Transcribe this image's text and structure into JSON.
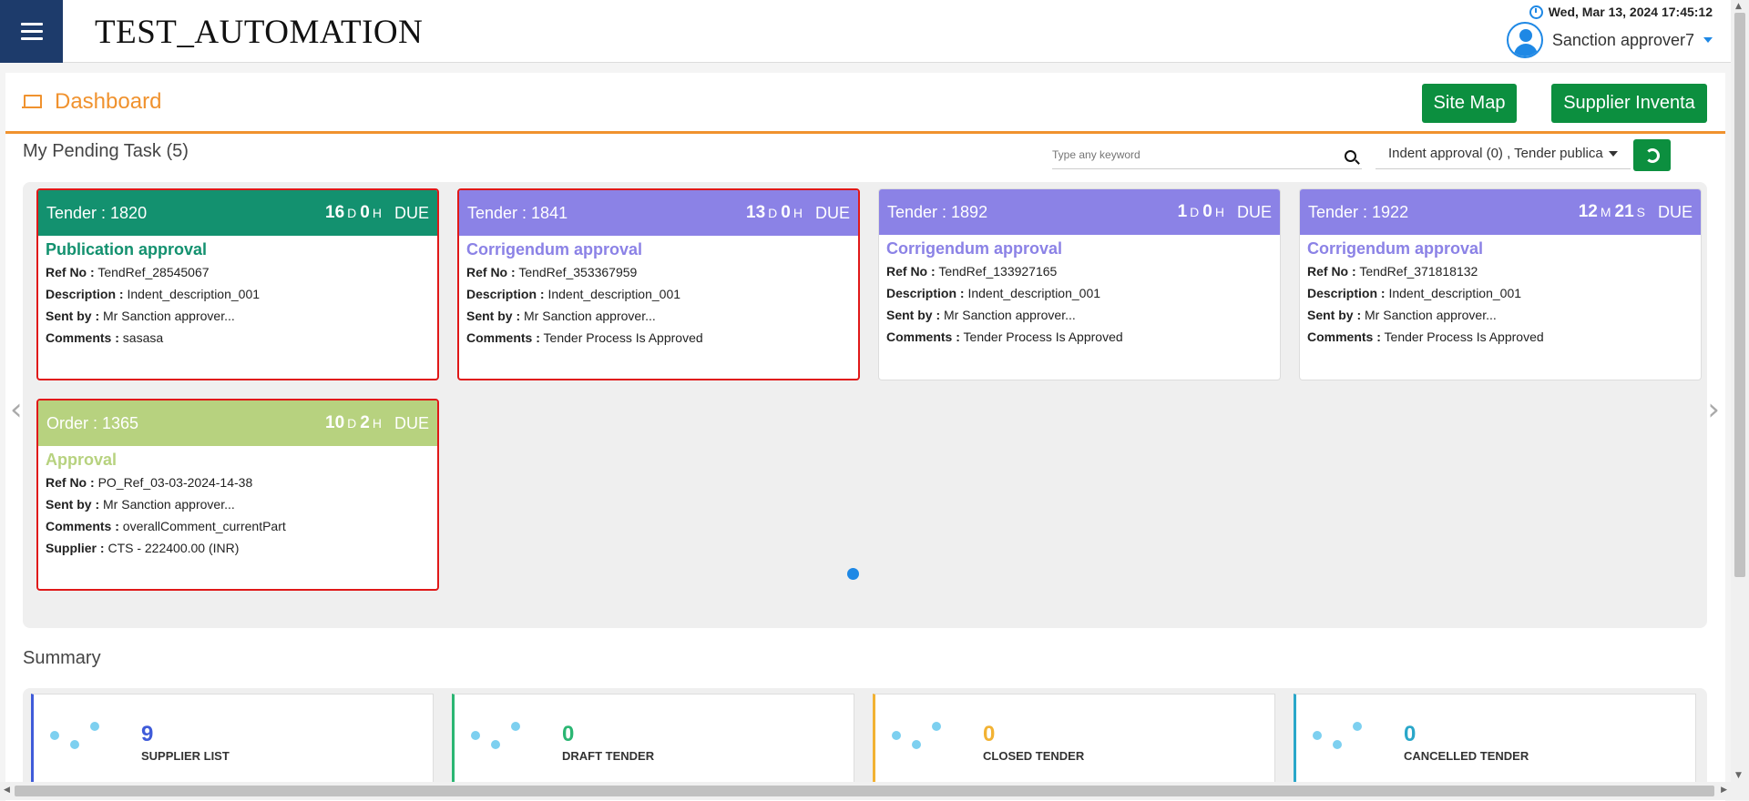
{
  "header": {
    "app_title": "TEST_AUTOMATION",
    "datetime": "Wed, Mar 13, 2024 17:45:12",
    "user_name": "Sanction approver7"
  },
  "dashboard": {
    "title": "Dashboard",
    "site_map_label": "Site Map",
    "supplier_inventory_label": "Supplier Inventa"
  },
  "pending": {
    "title": "My Pending Task (5)",
    "search_placeholder": "Type any keyword",
    "filter_value": "Indent approval (0)  , Tender publica"
  },
  "cards": [
    {
      "id": "Tender : 1820",
      "n1": "16",
      "u1": "D",
      "n2": "0",
      "u2": "H",
      "due": "DUE",
      "task": "Publication approval",
      "color": "#13916f",
      "overdue": true,
      "lines": [
        {
          "label": "Ref No :",
          "value": "TendRef_28545067"
        },
        {
          "label": "Description :",
          "value": "Indent_description_001"
        },
        {
          "label": "Sent by :",
          "value": "Mr Sanction approver..."
        },
        {
          "label": "Comments :",
          "value": "sasasa"
        }
      ]
    },
    {
      "id": "Tender : 1841",
      "n1": "13",
      "u1": "D",
      "n2": "0",
      "u2": "H",
      "due": "DUE",
      "task": "Corrigendum approval",
      "color": "#8b82e6",
      "overdue": true,
      "lines": [
        {
          "label": "Ref No :",
          "value": "TendRef_353367959"
        },
        {
          "label": "Description :",
          "value": "Indent_description_001"
        },
        {
          "label": "Sent by :",
          "value": "Mr Sanction approver..."
        },
        {
          "label": "Comments :",
          "value": "Tender Process Is Approved"
        }
      ]
    },
    {
      "id": "Tender : 1892",
      "n1": "1",
      "u1": "D",
      "n2": "0",
      "u2": "H",
      "due": "DUE",
      "task": "Corrigendum approval",
      "color": "#8b82e6",
      "overdue": false,
      "lines": [
        {
          "label": "Ref No :",
          "value": "TendRef_133927165"
        },
        {
          "label": "Description :",
          "value": "Indent_description_001"
        },
        {
          "label": "Sent by :",
          "value": "Mr Sanction approver..."
        },
        {
          "label": "Comments :",
          "value": "Tender Process Is Approved"
        }
      ]
    },
    {
      "id": "Tender : 1922",
      "n1": "12",
      "u1": "M",
      "n2": "21",
      "u2": "S",
      "due": "DUE",
      "task": "Corrigendum approval",
      "color": "#8b82e6",
      "overdue": false,
      "lines": [
        {
          "label": "Ref No :",
          "value": "TendRef_371818132"
        },
        {
          "label": "Description :",
          "value": "Indent_description_001"
        },
        {
          "label": "Sent by :",
          "value": "Mr Sanction approver..."
        },
        {
          "label": "Comments :",
          "value": "Tender Process Is Approved"
        }
      ]
    },
    {
      "id": "Order : 1365",
      "n1": "10",
      "u1": "D",
      "n2": "2",
      "u2": "H",
      "due": "DUE",
      "task": "Approval",
      "color": "#b7d27f",
      "overdue": true,
      "lines": [
        {
          "label": "Ref No :",
          "value": "PO_Ref_03-03-2024-14-38"
        },
        {
          "label": "Sent by :",
          "value": "Mr Sanction approver..."
        },
        {
          "label": "Comments :",
          "value": "overallComment_currentPart"
        },
        {
          "label": "Supplier :",
          "value": "CTS - 222400.00 (INR)"
        }
      ]
    }
  ],
  "summary": {
    "title": "Summary",
    "items": [
      {
        "count": "9",
        "label": "SUPPLIER LIST",
        "color": "#3f5bd9"
      },
      {
        "count": "0",
        "label": "DRAFT TENDER",
        "color": "#2bb673"
      },
      {
        "count": "0",
        "label": "CLOSED TENDER",
        "color": "#f2b233"
      },
      {
        "count": "0",
        "label": "CANCELLED TENDER",
        "color": "#2aa7c9"
      }
    ]
  }
}
